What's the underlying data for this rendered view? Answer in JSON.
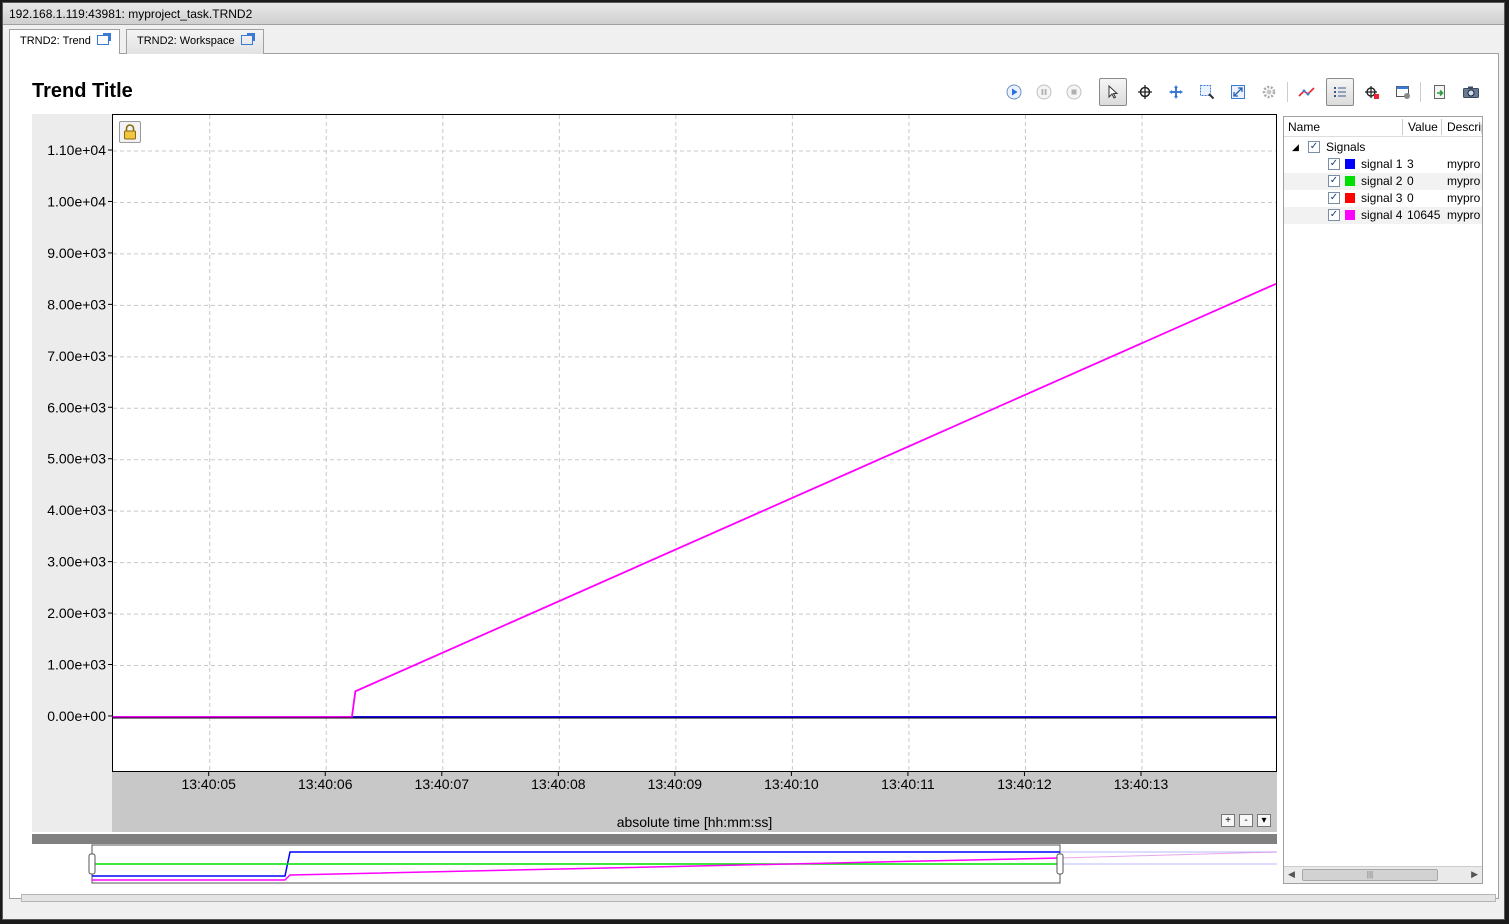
{
  "window": {
    "title": "192.168.1.119:43981: myproject_task.TRND2"
  },
  "tabs": [
    {
      "label": "TRND2: Trend",
      "active": true
    },
    {
      "label": "TRND2: Workspace",
      "active": false
    }
  ],
  "trend": {
    "title": "Trend Title",
    "xaxis_label": "absolute time [hh:mm:ss]"
  },
  "toolbar": {
    "icons": [
      "play-icon",
      "pause-icon",
      "stop-icon",
      "pointer-icon",
      "crosshair-icon",
      "pan-icon",
      "zoom-box-icon",
      "zoom-fit-icon",
      "settings-icon",
      "line-style-icon",
      "legend-list-icon",
      "cursor-add-icon",
      "window-settings-icon",
      "export-icon",
      "camera-icon"
    ]
  },
  "legend": {
    "headers": {
      "name": "Name",
      "value": "Value",
      "description": "Descrip"
    },
    "group": "Signals",
    "signals": [
      {
        "name": "signal 1",
        "value": "3",
        "description": "mypro",
        "color": "#0000ff"
      },
      {
        "name": "signal 2",
        "value": "0",
        "description": "mypro",
        "color": "#00e000"
      },
      {
        "name": "signal 3",
        "value": "0",
        "description": "mypro",
        "color": "#ff0000"
      },
      {
        "name": "signal 4",
        "value": "10645",
        "description": "mypro",
        "color": "#ff00ff"
      }
    ]
  },
  "chart_data": {
    "type": "line",
    "title": "Trend Title",
    "xlabel": "absolute time [hh:mm:ss]",
    "ylabel": "",
    "x_ticks": [
      "13:40:05",
      "13:40:06",
      "13:40:07",
      "13:40:08",
      "13:40:09",
      "13:40:10",
      "13:40:11",
      "13:40:12",
      "13:40:13"
    ],
    "y_ticks": [
      "0.00e+00",
      "1.00e+03",
      "2.00e+03",
      "3.00e+03",
      "4.00e+03",
      "5.00e+03",
      "6.00e+03",
      "7.00e+03",
      "8.00e+03",
      "9.00e+03",
      "1.00e+04",
      "1.10e+04"
    ],
    "xlim": [
      "13:40:04.17",
      "13:40:14.15"
    ],
    "ylim": [
      -1050,
      11700
    ],
    "grid": true,
    "series": [
      {
        "name": "signal 2",
        "color": "#00e000",
        "x": [
          "13:40:04.17",
          "13:40:14.15"
        ],
        "y": [
          0,
          0
        ]
      },
      {
        "name": "signal 3",
        "color": "#ff0000",
        "x": [
          "13:40:04.17",
          "13:40:14.15"
        ],
        "y": [
          0,
          0
        ]
      },
      {
        "name": "signal 1",
        "color": "#0000ff",
        "x": [
          "13:40:04.17",
          "13:40:14.15"
        ],
        "y": [
          0,
          0
        ]
      },
      {
        "name": "signal 4",
        "color": "#ff00ff",
        "x": [
          "13:40:04.17",
          "13:40:06.22",
          "13:40:06.22",
          "13:40:06.25",
          "13:40:14.15"
        ],
        "y": [
          0,
          0,
          0,
          500,
          8420
        ]
      }
    ]
  }
}
